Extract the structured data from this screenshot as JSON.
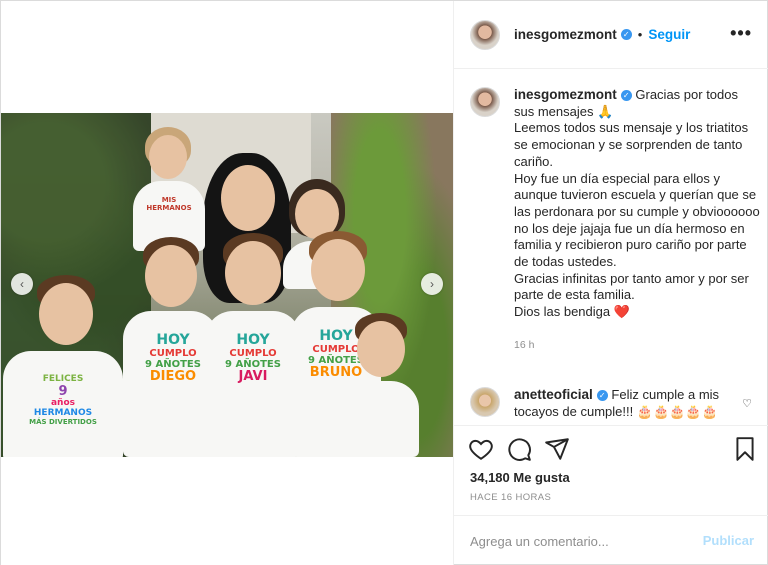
{
  "post": {
    "username": "inesgomezmont",
    "follow_label": "Seguir",
    "more_label": "•••",
    "carousel_prev": "‹",
    "carousel_next": "›",
    "photo_alt": "",
    "shirts": {
      "kid1": [
        "FELICES",
        "9",
        "años",
        "HERMANOS",
        "MÁS DIVERTIDOS"
      ],
      "kid2": [
        "HOY",
        "CUMPLO",
        "9 AÑOTES",
        "DIEGO"
      ],
      "kid3": [
        "HOY",
        "CUMPLO",
        "9 AÑOTES",
        "JAVI"
      ],
      "kid4": [
        "HOY",
        "CUMPLO",
        "9 AÑOTES",
        "BRUNO"
      ],
      "toddler": [
        "MIS",
        "HERMANOS"
      ]
    }
  },
  "caption": {
    "username": "inesgomezmont",
    "lines": [
      "Gracias por todos sus mensajes 🙏",
      "Leemos todos sus mensaje y los triatitos se emocionan y se sorprenden de tanto cariño.",
      "Hoy fue un día especial para ellos y aunque tuvieron escuela y querían que se las perdonara por su cumple y obvioooooo no los deje jajaja fue un día hermoso en familia y recibieron puro cariño por parte de todas ustedes.",
      "Gracias infinitas por tanto amor y por ser parte de esta familia.",
      "Dios las bendiga ❤️"
    ],
    "time": "16 h"
  },
  "comment": {
    "username": "anetteoficial",
    "text": "Feliz cumple a mis tocayos de cumple!!! 🎂🎂🎂🎂🎂",
    "like_icon": "♡"
  },
  "actions": {
    "likes": "34,180 Me gusta",
    "ago": "HACE 16 HORAS"
  },
  "add_comment": {
    "placeholder": "Agrega un comentario...",
    "publish": "Publicar"
  },
  "colors": {
    "accent": "#0095f6",
    "verified": "#3897f0",
    "publish_disabled": "#b2dffc"
  }
}
